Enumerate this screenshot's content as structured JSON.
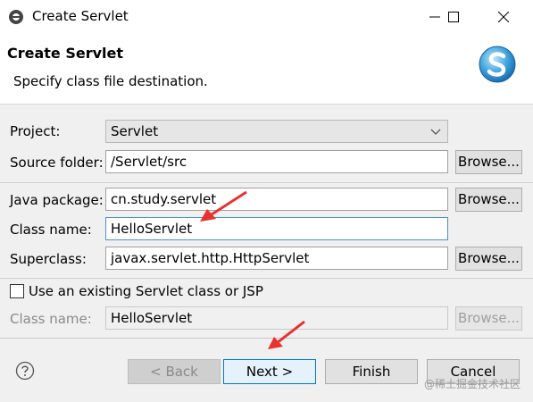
{
  "window": {
    "title": "Create Servlet",
    "icon": "eclipse-icon",
    "controls": [
      "minimize-icon",
      "maximize-icon",
      "close-icon"
    ]
  },
  "header": {
    "title": "Create Servlet",
    "description": "Specify class file destination.",
    "logo": "servlet-s-logo"
  },
  "form": {
    "project": {
      "label": "Project:",
      "value": "Servlet"
    },
    "source_folder": {
      "label": "Source folder:",
      "value": "/Servlet/src",
      "button": "Browse..."
    },
    "java_package": {
      "label": "Java package:",
      "value": "cn.study.servlet",
      "button": "Browse..."
    },
    "class_name": {
      "label": "Class name:",
      "value": "HelloServlet"
    },
    "superclass": {
      "label": "Superclass:",
      "value": "javax.servlet.http.HttpServlet",
      "button": "Browse..."
    },
    "use_existing": {
      "label": "Use an existing Servlet class or JSP",
      "checked": false
    },
    "existing_class_name": {
      "label": "Class name:",
      "value": "HelloServlet",
      "button": "Browse..."
    }
  },
  "footer": {
    "help_icon": "help-icon",
    "back": "< Back",
    "next": "Next >",
    "finish": "Finish",
    "cancel": "Cancel"
  },
  "watermark": "@稀土掘金技术社区",
  "colors": {
    "annotation_arrow": "#e8322e",
    "focus_border": "#4a8fd6",
    "default_button_border": "#0078d7"
  }
}
